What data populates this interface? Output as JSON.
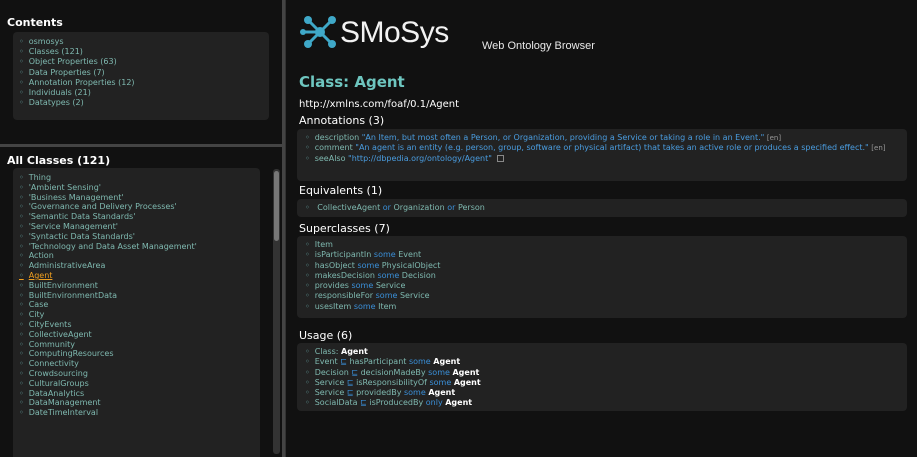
{
  "contents": {
    "title": "Contents",
    "items": [
      "osmosys",
      "Classes (121)",
      "Object Properties (63)",
      "Data Properties (7)",
      "Annotation Properties (12)",
      "Individuals (21)",
      "Datatypes (2)"
    ]
  },
  "classes": {
    "title": "All Classes (121)",
    "items": [
      "Thing",
      "'Ambient Sensing'",
      "'Business Management'",
      "'Governance and Delivery Processes'",
      "'Semantic Data Standards'",
      "'Service Management'",
      "'Syntactic Data Standards'",
      "'Technology and Data Asset Management'",
      "Action",
      "AdministrativeArea",
      "Agent",
      "BuiltEnvironment",
      "BuiltEnvironmentData",
      "Case",
      "City",
      "CityEvents",
      "CollectiveAgent",
      "Community",
      "ComputingResources",
      "Connectivity",
      "Crowdsourcing",
      "CulturalGroups",
      "DataAnalytics",
      "DataManagement",
      "DateTimeInterval"
    ],
    "active_index": 10
  },
  "header": {
    "logo_text": "SMoSys",
    "subtitle": "Web Ontology Browser"
  },
  "class": {
    "title": "Class: Agent",
    "uri": "http://xmlns.com/foaf/0.1/Agent"
  },
  "annotations": {
    "heading": "Annotations (3)",
    "rows": [
      {
        "prop": "description",
        "value": "\"An Item, but most often a Person, or Organization, providing a Service or taking a role in an Event.\"",
        "lang": "[en]"
      },
      {
        "prop": "comment",
        "value": "\"An agent is an entity (e.g. person, group, software or physical artifact) that takes an active role or produces a specified effect.\"",
        "lang": "[en]"
      },
      {
        "prop": "seeAlso",
        "value": "\"http://dbpedia.org/ontology/Agent\"",
        "lang": ""
      }
    ]
  },
  "equivalents": {
    "heading": "Equivalents (1)",
    "row": {
      "a": "CollectiveAgent",
      "or1": "or",
      "b": "Organization",
      "or2": "or",
      "c": "Person"
    }
  },
  "superclasses": {
    "heading": "Superclasses (7)",
    "rows": [
      {
        "prop": "Item",
        "kw": "",
        "target": ""
      },
      {
        "prop": "isParticipantIn",
        "kw": "some",
        "target": "Event"
      },
      {
        "prop": "hasObject",
        "kw": "some",
        "target": "PhysicalObject"
      },
      {
        "prop": "makesDecision",
        "kw": "some",
        "target": "Decision"
      },
      {
        "prop": "provides",
        "kw": "some",
        "target": "Service"
      },
      {
        "prop": "responsibleFor",
        "kw": "some",
        "target": "Service"
      },
      {
        "prop": "usesItem",
        "kw": "some",
        "target": "Item"
      }
    ]
  },
  "usage": {
    "heading": "Usage (6)",
    "rows": [
      {
        "a": "Class:",
        "sym": "",
        "b": "",
        "kw": "",
        "target": "Agent"
      },
      {
        "a": "Event",
        "sym": "⊑",
        "b": "hasParticipant",
        "kw": "some",
        "target": "Agent"
      },
      {
        "a": "Decision",
        "sym": "⊑",
        "b": "decisionMadeBy",
        "kw": "some",
        "target": "Agent"
      },
      {
        "a": "Service",
        "sym": "⊑",
        "b": "isResponsibilityOf",
        "kw": "some",
        "target": "Agent"
      },
      {
        "a": "Service",
        "sym": "⊑",
        "b": "providedBy",
        "kw": "some",
        "target": "Agent"
      },
      {
        "a": "SocialData",
        "sym": "⊑",
        "b": "isProducedBy",
        "kw": "only",
        "target": "Agent"
      }
    ]
  }
}
